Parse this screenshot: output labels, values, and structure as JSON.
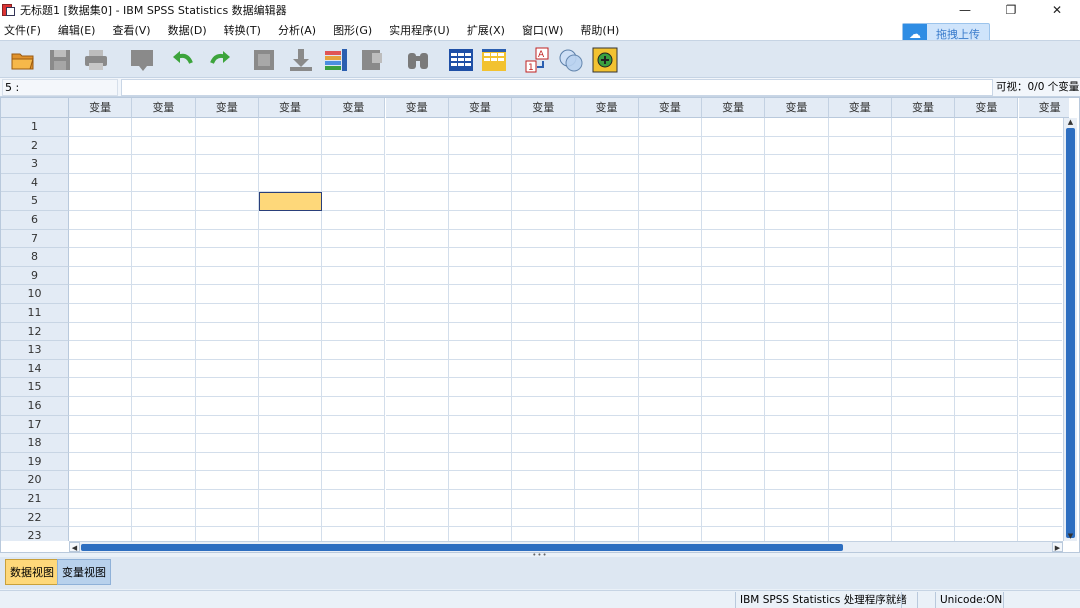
{
  "window": {
    "title": "无标题1 [数据集0] - IBM SPSS Statistics 数据编辑器",
    "controls": {
      "minimize": "—",
      "restore": "❐",
      "close": "✕"
    }
  },
  "menu": [
    "文件(F)",
    "编辑(E)",
    "查看(V)",
    "数据(D)",
    "转换(T)",
    "分析(A)",
    "图形(G)",
    "实用程序(U)",
    "扩展(X)",
    "窗口(W)",
    "帮助(H)"
  ],
  "upload": {
    "label": "拖拽上传"
  },
  "toolbar_icons": [
    "open-folder-icon",
    "save-icon",
    "print-icon",
    "dialog-recall-icon",
    "undo-icon",
    "redo-icon",
    "goto-case-icon",
    "goto-variable-icon",
    "variables-icon",
    "run-descriptive-icon",
    "find-icon",
    "insert-cases-icon",
    "insert-variable-icon",
    "value-labels-icon",
    "use-variable-sets-icon",
    "show-all-variables-icon"
  ],
  "editor": {
    "cell_ref": "5 :",
    "cell_value": "",
    "visible_vars": "可视：0/0 个变量"
  },
  "grid": {
    "column_header": "变量",
    "column_count": 16,
    "rows": [
      "1",
      "2",
      "3",
      "4",
      "5",
      "6",
      "7",
      "8",
      "9",
      "10",
      "11",
      "12",
      "13",
      "14",
      "15",
      "16",
      "17",
      "18",
      "19",
      "20",
      "21",
      "22",
      "23"
    ],
    "active_row": 5,
    "active_col": 4
  },
  "tabs": {
    "data_view": "数据视图",
    "variable_view": "变量视图"
  },
  "status": {
    "processor": "IBM SPSS Statistics 处理程序就绪",
    "unicode": "Unicode:ON"
  },
  "colors": {
    "active_cell": "#fed87a",
    "accent": "#2d6ec0",
    "header_bg": "#e3ebf5"
  }
}
